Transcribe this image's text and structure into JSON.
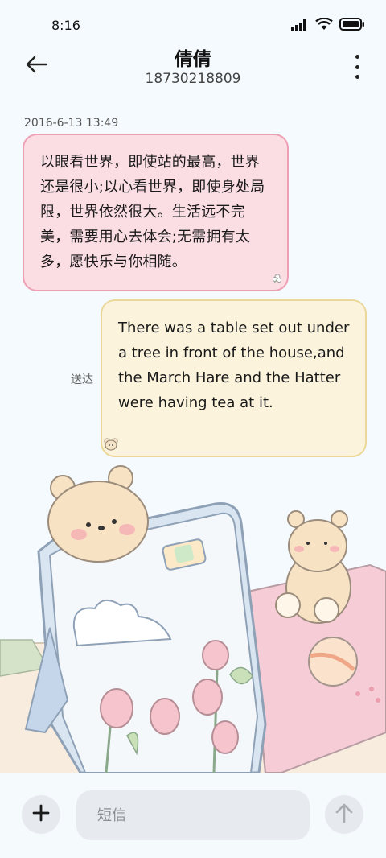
{
  "status_bar": {
    "time": "8:16",
    "icons": [
      "signal-icon",
      "wifi-icon",
      "battery-icon"
    ]
  },
  "header": {
    "contact_name": "倩倩",
    "contact_number": "18730218809",
    "back_icon": "arrow-left-icon",
    "menu_icon": "more-vertical-icon"
  },
  "conversation": {
    "timestamp": "2016-6-13 13:49",
    "messages": [
      {
        "direction": "incoming",
        "text": "以眼看世界，即使站的最高，世界还是很小;以心看世界，即使身处局限，世界依然很大。生活远不完美，需要用心去体会;无需拥有太多，愿快乐与你相随。"
      },
      {
        "direction": "outgoing",
        "text": "There was a table set out under a tree in front of the house,and the March Hare and the Hatter were having tea at it.",
        "status": "送达"
      }
    ]
  },
  "composer": {
    "placeholder": "短信",
    "add_icon": "plus-icon",
    "send_icon": "arrow-up-icon"
  },
  "colors": {
    "background": "#f4fafd",
    "incoming_bubble": "#fbdde4",
    "incoming_border": "#ee9fb4",
    "outgoing_bubble": "#fbf3dc",
    "outgoing_border": "#ecd79a"
  }
}
